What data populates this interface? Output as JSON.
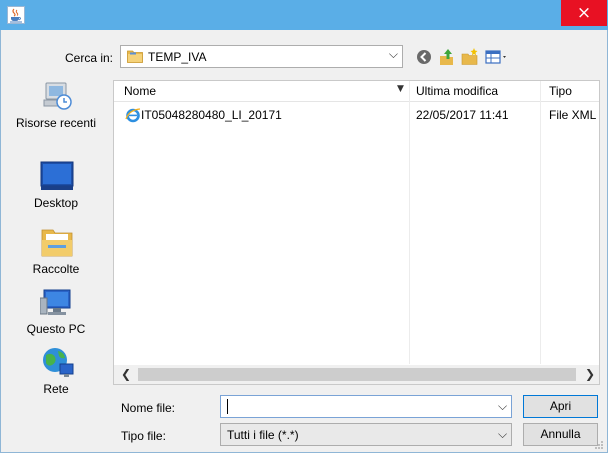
{
  "window": {
    "close_glyph": "×",
    "icon": "java-cup-icon"
  },
  "look_in": {
    "label": "Cerca in:",
    "value": "TEMP_IVA"
  },
  "toolbar": {
    "icons": [
      "back-icon",
      "up-folder-icon",
      "new-folder-icon",
      "view-menu-icon"
    ]
  },
  "places": [
    {
      "label": "Risorse recenti",
      "icon": "recent-items-icon"
    },
    {
      "label": "Desktop",
      "icon": "desktop-icon"
    },
    {
      "label": "Raccolte",
      "icon": "libraries-icon"
    },
    {
      "label": "Questo PC",
      "icon": "this-pc-icon"
    },
    {
      "label": "Rete",
      "icon": "network-icon"
    }
  ],
  "file_list": {
    "columns": [
      "Nome",
      "Ultima modifica",
      "Tipo"
    ],
    "rows": [
      {
        "name": "IT05048280480_LI_20171",
        "modified": "22/05/2017 11:41",
        "type": "File XML"
      }
    ]
  },
  "file_name": {
    "label": "Nome file:",
    "value": ""
  },
  "file_type": {
    "label": "Tipo file:",
    "value": "Tutti i file (*.*)"
  },
  "buttons": {
    "open": "Apri",
    "cancel": "Annulla"
  },
  "colors": {
    "titlebar": "#5aaee7",
    "close": "#e81123",
    "accent": "#0078d7"
  }
}
